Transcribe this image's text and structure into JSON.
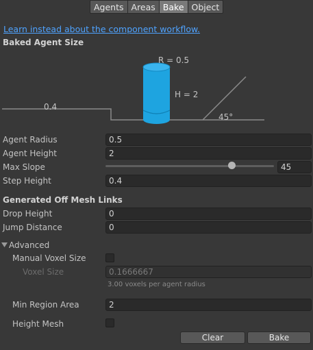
{
  "tabs": [
    {
      "label": "Agents"
    },
    {
      "label": "Areas"
    },
    {
      "label": "Bake"
    },
    {
      "label": "Object"
    }
  ],
  "link_text": "Learn instead about the component workflow.",
  "baked_agent_size": {
    "header": "Baked Agent Size",
    "diagram": {
      "radius_label": "R = 0.5",
      "height_label": "H = 2",
      "step_label": "0.4",
      "slope_label": "45°"
    }
  },
  "fields": {
    "agent_radius": {
      "label": "Agent Radius",
      "value": "0.5"
    },
    "agent_height": {
      "label": "Agent Height",
      "value": "2"
    },
    "max_slope": {
      "label": "Max Slope",
      "value": "45",
      "slider_fraction": 0.75
    },
    "step_height": {
      "label": "Step Height",
      "value": "0.4"
    }
  },
  "off_mesh": {
    "header": "Generated Off Mesh Links",
    "drop_height": {
      "label": "Drop Height",
      "value": "0"
    },
    "jump_distance": {
      "label": "Jump Distance",
      "value": "0"
    }
  },
  "advanced": {
    "header": "Advanced",
    "manual_voxel_size": {
      "label": "Manual Voxel Size",
      "checked": false
    },
    "voxel_size": {
      "label": "Voxel Size",
      "value": "0.1666667"
    },
    "voxel_hint": "3.00 voxels per agent radius",
    "min_region_area": {
      "label": "Min Region Area",
      "value": "2"
    },
    "height_mesh": {
      "label": "Height Mesh",
      "checked": false
    }
  },
  "buttons": {
    "clear": "Clear",
    "bake": "Bake"
  },
  "colors": {
    "background": "#383838",
    "cylinder": "#1ea4e0",
    "link": "#4fa3ff"
  }
}
